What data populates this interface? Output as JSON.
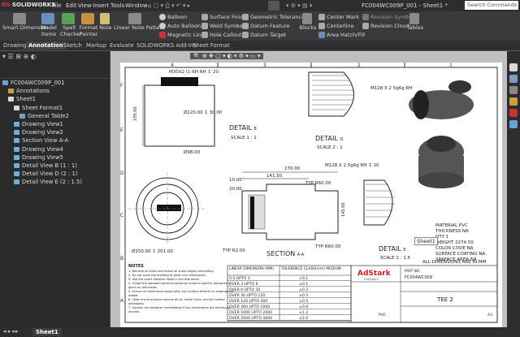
{
  "app": {
    "name": "SOLIDWORKS",
    "title": "FC004WC009P_001 - Sheet1 *",
    "search_placeholder": "Search Commands"
  },
  "menu": [
    "File",
    "Edit",
    "View",
    "Insert",
    "Tools",
    "Window"
  ],
  "ribbon": {
    "big": [
      {
        "label1": "Smart Dimension",
        "label2": ""
      },
      {
        "label1": "Model",
        "label2": "Items"
      },
      {
        "label1": "Spell",
        "label2": "Checker"
      },
      {
        "label1": "Format",
        "label2": "Painter"
      },
      {
        "label1": "Note",
        "label2": ""
      },
      {
        "label1": "Linear Note Pattern",
        "label2": ""
      }
    ],
    "col1": [
      "Balloon",
      "Auto Balloon",
      "Magnetic Line"
    ],
    "col2": [
      "Surface Finish",
      "Weld Symbol",
      "Hole Callout"
    ],
    "col3": [
      "Geometric Tolerance",
      "Datum Feature",
      "Datum Target"
    ],
    "blocks": "Blocks",
    "col4": [
      "Center Mark",
      "Centerline",
      "Area Hatch/Fill"
    ],
    "col5": [
      "Revision Symbol",
      "Revision Cloud"
    ],
    "tables": "Tables"
  },
  "tabs": [
    "Drawing",
    "Annotation",
    "Sketch",
    "Markup",
    "Evaluate",
    "SOLIDWORKS Add-Ins",
    "Sheet Format"
  ],
  "active_tab": "Annotation",
  "tree": [
    {
      "label": "FC004WC009P_001",
      "indent": 0,
      "icon": "#7a9cc6"
    },
    {
      "label": "Annotations",
      "indent": 1,
      "icon": "#c8a040"
    },
    {
      "label": "Sheet1",
      "indent": 1,
      "icon": "#d8d8d8"
    },
    {
      "label": "Sheet Format1",
      "indent": 2,
      "icon": "#d8d8d8"
    },
    {
      "label": "General Table2",
      "indent": 3,
      "icon": "#7a9cc6"
    },
    {
      "label": "Drawing View1",
      "indent": 2,
      "icon": "#6ab0d8"
    },
    {
      "label": "Drawing View2",
      "indent": 2,
      "icon": "#6ab0d8"
    },
    {
      "label": "Section View A-A",
      "indent": 2,
      "icon": "#6ab0d8"
    },
    {
      "label": "Drawing View4",
      "indent": 2,
      "icon": "#6ab0d8"
    },
    {
      "label": "Drawing View5",
      "indent": 2,
      "icon": "#6ab0d8"
    },
    {
      "label": "Detail View B (1 : 1)",
      "indent": 2,
      "icon": "#6ab0d8"
    },
    {
      "label": "Detail View D (2 : 1)",
      "indent": 2,
      "icon": "#6ab0d8"
    },
    {
      "label": "Detail View E (2 : 1.5)",
      "indent": 2,
      "icon": "#6ab0d8"
    }
  ],
  "drawing": {
    "thread_b": "M30X2 (1-6H RH ↧ 20",
    "dia_b1": "Ø120.00 ↧ 30.00",
    "dia_b2": "Ø98.00",
    "dim_235": "235.00",
    "detail_b": "DETAIL",
    "detail_b_letter": "B",
    "detail_b_scale": "SCALE 1 : 1",
    "thread_d": "M128 X 2 5g6g RH",
    "detail_d": "DETAIL",
    "detail_d_letter": "D",
    "detail_d_scale": "SCALE 2 : 1",
    "thread_e": "M128 X 2 5g6g RH ↧ 10",
    "detail_e": "DETAIL",
    "detail_e_letter": "E",
    "detail_e_scale": "SCALE 2 : 1.5",
    "dim_270": "270.00",
    "dim_141": "141.50",
    "dim_10": "10.00",
    "dim_20": "20.00",
    "typ_r60_1": "TYP R60.00",
    "typ_r60_2": "TYP R60.00",
    "typ_r2": "TYP R2.00",
    "dia_150": "Ø150.00 ↧ 201.00",
    "section": "SECTION",
    "section_letter": "A-A",
    "dim_145": "145.00",
    "material": [
      "MATERIAL PVC",
      "THICKNESS NA",
      "QTY 1",
      "WEIGHT 2274.50",
      "COLOR CODE NA",
      "SURFACE COATING NA",
      "SRAFACE AREA NA"
    ],
    "all_dims": "ALL DIMENSIONS ARE IN  MM",
    "notes_title": "NOTES",
    "notes": [
      "1. Remove all sharp and break all sharp edges completely.",
      "2. Do not scale the drawing to given any dimensions.",
      "3. Use the exact material listed in the title block.",
      "4. Follow the standard general tolerance unless a specific tolerance is",
      "   given on dimension.",
      "5. Ensure all dimensions apply after any surface finishes or coatings are",
      "   added.",
      "6. Clean the final parts remove all oil, metal chips, and dirt before",
      "   packaging.",
      "7. Contact the designer immediately if any dimensions are missing or",
      "   unclear."
    ],
    "tol_head": [
      "LINEAR DIMENSION (MM)",
      "TOLERENCE CLASS(mm) MEDIUM"
    ],
    "tol_rows": [
      [
        "0.5 UPTO 3",
        "±0.1"
      ],
      [
        "OVER 3 UPTO 6",
        "±0.1"
      ],
      [
        "OVER 6 UPTO 30",
        "±0.2"
      ],
      [
        "OVER 30 UPTO 120",
        "±0.3"
      ],
      [
        "OVER 120 UPTO 400",
        "±0.5"
      ],
      [
        "OVER 400 UPTO 1000",
        "±0.8"
      ],
      [
        "OVER 1000 UPTO 2000",
        "±1.2"
      ],
      [
        "OVER 2000 UPTO 4000",
        "±2.0"
      ]
    ],
    "company": "AdStark",
    "company_sub": "Engineers",
    "part_no_label": "PART NO.",
    "part_no": "FC004WC009",
    "part_name": "TEE 2",
    "material_cell": "PVC",
    "size": "A3",
    "tooltip": "Sheet1",
    "grid_top": [
      "4",
      "3",
      "2",
      "1"
    ],
    "grid_left": [
      "F",
      "E",
      "D",
      "C",
      "B",
      "A"
    ]
  },
  "bottom": {
    "sheet_tab": "Sheet1"
  },
  "colors": {
    "accent": "#1e6fd9",
    "sheet": "#ffffff",
    "canvas": "#bfbfbf",
    "panel": "#2b2b2b"
  }
}
